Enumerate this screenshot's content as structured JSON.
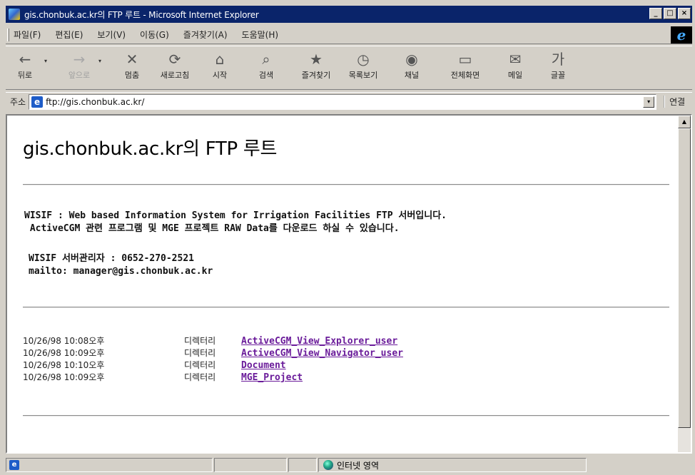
{
  "window": {
    "title": "gis.chonbuk.ac.kr의 FTP 루트 - Microsoft Internet Explorer",
    "controls": {
      "minimize": "_",
      "maximize": "□",
      "close": "×"
    }
  },
  "menu": {
    "items": [
      "파일(F)",
      "편집(E)",
      "보기(V)",
      "이동(G)",
      "즐겨찾기(A)",
      "도움말(H)"
    ],
    "logo": "e"
  },
  "toolbar": {
    "back": "뒤로",
    "forward": "앞으로",
    "stop": "멈춤",
    "refresh": "새로고침",
    "home": "시작",
    "search": "검색",
    "favorites": "즐겨찾기",
    "history": "목록보기",
    "channels": "채널",
    "fullscreen": "전체화면",
    "mail": "메일",
    "font": "글꼴",
    "icons": {
      "back": "←",
      "forward": "→",
      "stop": "✕",
      "refresh": "⟳",
      "home": "⌂",
      "search": "⌕",
      "favorites": "★",
      "history": "◷",
      "channels": "◉",
      "fullscreen": "▭",
      "mail": "✉",
      "font": "가"
    },
    "dropdown": "▾"
  },
  "address": {
    "label": "주소",
    "url": "ftp://gis.chonbuk.ac.kr/",
    "links_label": "연결",
    "dropdown": "▾",
    "page_icon": "e"
  },
  "page": {
    "title": "gis.chonbuk.ac.kr의 FTP 루트",
    "message_line1": "WISIF : Web based Information System for Irrigation Facilities FTP 서버입니다.",
    "message_line2": " ActiveCGM 관련 프로그램 및 MGE 프로젝트 RAW Data를 다운로드 하실 수 있습니다.",
    "admin_line1": "WISIF 서버관리자 : 0652-270-2521",
    "admin_line2": "mailto: manager@gis.chonbuk.ac.kr",
    "listing": [
      {
        "date": "10/26/98 10:08오후",
        "kind": "디렉터리",
        "name": "ActiveCGM_View_Explorer_user"
      },
      {
        "date": "10/26/98 10:09오후",
        "kind": "디렉터리",
        "name": "ActiveCGM_View_Navigator_user"
      },
      {
        "date": "10/26/98 10:10오후",
        "kind": "디렉터리",
        "name": "Document"
      },
      {
        "date": "10/26/98 10:09오후",
        "kind": "디렉터리",
        "name": "MGE_Project"
      }
    ]
  },
  "status": {
    "zone": "인터넷 영역",
    "ie_icon": "e"
  }
}
